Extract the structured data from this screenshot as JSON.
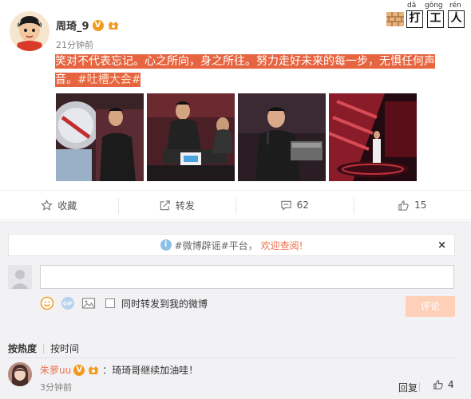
{
  "post": {
    "username": "周琦_9",
    "time": "21分钟前",
    "text_highlighted": "笑对不代表忘记。心之所向，身之所往。努力走好未来的每一步，无惧任何声音。",
    "topic": "#吐槽大会#",
    "verified_icon": "v-badge-icon",
    "level_icon": "member-badge-icon"
  },
  "brand": {
    "chars": [
      "打",
      "工",
      "人"
    ],
    "pinyin": [
      "dǎ",
      "gōng",
      "rén"
    ]
  },
  "actions": {
    "favorite_label": "收藏",
    "repost_label": "转发",
    "comment_count": "62",
    "like_count": "15"
  },
  "notice": {
    "text": "#微博辟谣#平台，",
    "link": "欢迎查阅!",
    "close": "×"
  },
  "composer": {
    "placeholder": "",
    "gif_label": "GIF",
    "repost_option": "同时转发到我的微博",
    "submit_label": "评论"
  },
  "sort": {
    "active": "按热度",
    "other": "按时间"
  },
  "comment": {
    "user": "朱萝uu",
    "text": "：琦琦哥继续加油哇！",
    "time": "3分钟前",
    "reply_label": "回复",
    "like_count": "4"
  },
  "colors": {
    "accent": "#eb7350",
    "highlight": "#e6643f",
    "submit_disabled": "#ffd0b8"
  }
}
